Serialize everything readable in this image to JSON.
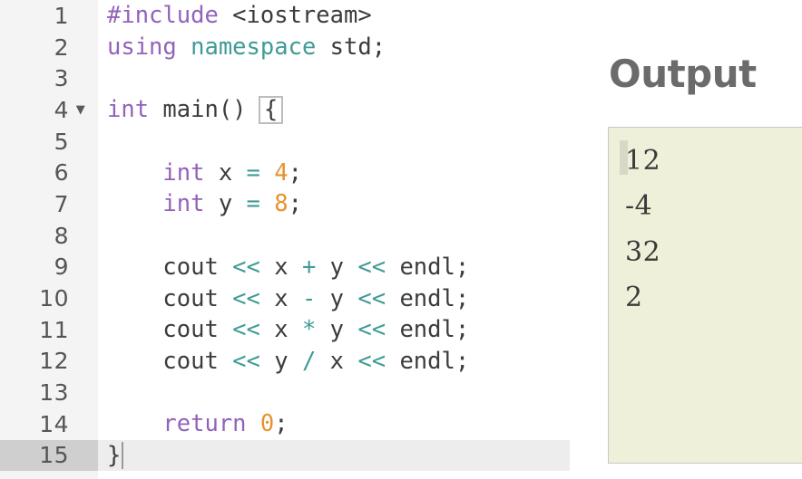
{
  "editor": {
    "name": "cpp-code-editor",
    "language": "C++",
    "active_line": 15,
    "fold_marker_lines": [
      4
    ],
    "cursor_line": 15,
    "lines": [
      {
        "number": "1",
        "fold": "",
        "tokens": [
          {
            "t": "#include ",
            "c": "kw"
          },
          {
            "t": "<iostream>",
            "c": "plain"
          }
        ]
      },
      {
        "number": "2",
        "fold": "",
        "tokens": [
          {
            "t": "using ",
            "c": "kw"
          },
          {
            "t": "namespace ",
            "c": "ns"
          },
          {
            "t": "std;",
            "c": "plain"
          }
        ]
      },
      {
        "number": "3",
        "fold": "",
        "tokens": []
      },
      {
        "number": "4",
        "fold": "▼",
        "tokens": [
          {
            "t": "int ",
            "c": "type"
          },
          {
            "t": "main() ",
            "c": "plain"
          },
          {
            "t": "{",
            "c": "brace"
          }
        ]
      },
      {
        "number": "5",
        "fold": "",
        "tokens": []
      },
      {
        "number": "6",
        "fold": "",
        "tokens": [
          {
            "t": "    int ",
            "c": "type"
          },
          {
            "t": "x ",
            "c": "plain"
          },
          {
            "t": "= ",
            "c": "op"
          },
          {
            "t": "4",
            "c": "num"
          },
          {
            "t": ";",
            "c": "plain"
          }
        ]
      },
      {
        "number": "7",
        "fold": "",
        "tokens": [
          {
            "t": "    int ",
            "c": "type"
          },
          {
            "t": "y ",
            "c": "plain"
          },
          {
            "t": "= ",
            "c": "op"
          },
          {
            "t": "8",
            "c": "num"
          },
          {
            "t": ";",
            "c": "plain"
          }
        ]
      },
      {
        "number": "8",
        "fold": "",
        "tokens": []
      },
      {
        "number": "9",
        "fold": "",
        "tokens": [
          {
            "t": "    cout ",
            "c": "plain"
          },
          {
            "t": "<< ",
            "c": "op"
          },
          {
            "t": "x ",
            "c": "plain"
          },
          {
            "t": "+ ",
            "c": "op"
          },
          {
            "t": "y ",
            "c": "plain"
          },
          {
            "t": "<< ",
            "c": "op"
          },
          {
            "t": "endl;",
            "c": "plain"
          }
        ]
      },
      {
        "number": "10",
        "fold": "",
        "tokens": [
          {
            "t": "    cout ",
            "c": "plain"
          },
          {
            "t": "<< ",
            "c": "op"
          },
          {
            "t": "x ",
            "c": "plain"
          },
          {
            "t": "- ",
            "c": "op"
          },
          {
            "t": "y ",
            "c": "plain"
          },
          {
            "t": "<< ",
            "c": "op"
          },
          {
            "t": "endl;",
            "c": "plain"
          }
        ]
      },
      {
        "number": "11",
        "fold": "",
        "tokens": [
          {
            "t": "    cout ",
            "c": "plain"
          },
          {
            "t": "<< ",
            "c": "op"
          },
          {
            "t": "x ",
            "c": "plain"
          },
          {
            "t": "* ",
            "c": "op"
          },
          {
            "t": "y ",
            "c": "plain"
          },
          {
            "t": "<< ",
            "c": "op"
          },
          {
            "t": "endl;",
            "c": "plain"
          }
        ]
      },
      {
        "number": "12",
        "fold": "",
        "tokens": [
          {
            "t": "    cout ",
            "c": "plain"
          },
          {
            "t": "<< ",
            "c": "op"
          },
          {
            "t": "y ",
            "c": "plain"
          },
          {
            "t": "/ ",
            "c": "op"
          },
          {
            "t": "x ",
            "c": "plain"
          },
          {
            "t": "<< ",
            "c": "op"
          },
          {
            "t": "endl;",
            "c": "plain"
          }
        ]
      },
      {
        "number": "13",
        "fold": "",
        "tokens": []
      },
      {
        "number": "14",
        "fold": "",
        "tokens": [
          {
            "t": "    return ",
            "c": "kw"
          },
          {
            "t": "0",
            "c": "num"
          },
          {
            "t": ";",
            "c": "plain"
          }
        ]
      },
      {
        "number": "15",
        "fold": "",
        "tokens": [
          {
            "t": "}",
            "c": "plain"
          },
          {
            "t": "",
            "c": "caret"
          }
        ]
      }
    ]
  },
  "output": {
    "title": "Output",
    "lines": [
      "12",
      "-4",
      "32",
      "2"
    ]
  },
  "colors": {
    "keyword": "#9263ba",
    "operator": "#3f9b96",
    "number": "#e8922e",
    "plain": "#3c3c3c",
    "gutter_bg": "#f4f4f4",
    "active_gutter_bg": "#cfcfcf",
    "active_line_bg": "#ededed",
    "output_bg": "#eff0da",
    "output_border": "#c8c8c8",
    "output_title": "#6b6b6b"
  }
}
